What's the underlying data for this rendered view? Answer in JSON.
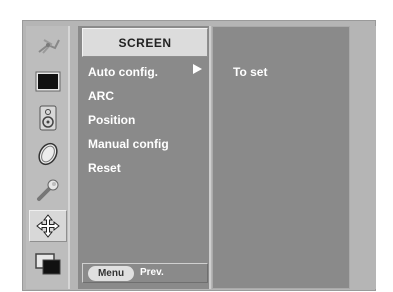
{
  "menu": {
    "tab_title": "SCREEN",
    "items": [
      {
        "label": "Auto config."
      },
      {
        "label": "ARC"
      },
      {
        "label": "Position"
      },
      {
        "label": "Manual config"
      },
      {
        "label": "Reset"
      }
    ],
    "selected_index": 0
  },
  "submenu": {
    "label": "To set"
  },
  "footer": {
    "menu_button": "Menu",
    "prev_label": "Prev."
  },
  "sidebar": {
    "icons": [
      {
        "name": "antenna-icon"
      },
      {
        "name": "picture-icon"
      },
      {
        "name": "speaker-icon"
      },
      {
        "name": "clock-icon"
      },
      {
        "name": "wrench-icon"
      },
      {
        "name": "screen-arrows-icon",
        "active": true
      },
      {
        "name": "pip-icon"
      }
    ]
  },
  "colors": {
    "menu_bg": "#8a8a8a",
    "frame_bg": "#b5b5b5",
    "text": "#ffffff"
  }
}
